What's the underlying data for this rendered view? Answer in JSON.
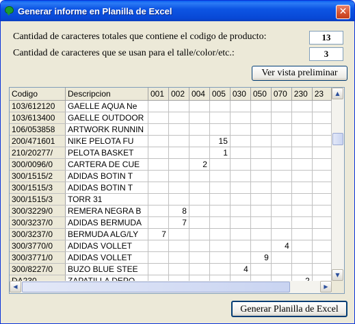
{
  "window": {
    "title": "Generar informe en Planilla de Excel",
    "close_symbol": "✕",
    "icon": "speech-bubble-icon"
  },
  "form": {
    "product_code_label": "Cantidad de caracteres totales que contiene el codigo de producto:",
    "product_code_value": "13",
    "size_color_label": "Cantidad de caracteres que se usan para el talle/color/etc.:",
    "size_color_value": "3",
    "preview_button": "Ver vista preliminar"
  },
  "grid": {
    "columns": [
      "Codigo",
      "Descripcion",
      "001",
      "002",
      "004",
      "005",
      "030",
      "050",
      "070",
      "230",
      "23"
    ],
    "rows": [
      {
        "codigo": "103/612120",
        "descripcion": "GAELLE AQUA Ne",
        "values": [
          "",
          "",
          "",
          "",
          "",
          "",
          "",
          "",
          ""
        ]
      },
      {
        "codigo": "103/613400",
        "descripcion": "GAELLE OUTDOOR",
        "values": [
          "",
          "",
          "",
          "",
          "",
          "",
          "",
          "",
          ""
        ]
      },
      {
        "codigo": "106/053858",
        "descripcion": "ARTWORK RUNNIN",
        "values": [
          "",
          "",
          "",
          "",
          "",
          "",
          "",
          "",
          ""
        ]
      },
      {
        "codigo": "200/471601",
        "descripcion": "NIKE PELOTA FU",
        "values": [
          "",
          "",
          "",
          "15",
          "",
          "",
          "",
          "",
          ""
        ]
      },
      {
        "codigo": "210/20277/",
        "descripcion": "PELOTA BASKET",
        "values": [
          "",
          "",
          "",
          "1",
          "",
          "",
          "",
          "",
          ""
        ]
      },
      {
        "codigo": "300/0096/0",
        "descripcion": "CARTERA DE CUE",
        "values": [
          "",
          "",
          "2",
          "",
          "",
          "",
          "",
          "",
          ""
        ]
      },
      {
        "codigo": "300/1515/2",
        "descripcion": "ADIDAS BOTIN T",
        "values": [
          "",
          "",
          "",
          "",
          "",
          "",
          "",
          "",
          ""
        ]
      },
      {
        "codigo": "300/1515/3",
        "descripcion": "ADIDAS BOTIN T",
        "values": [
          "",
          "",
          "",
          "",
          "",
          "",
          "",
          "",
          ""
        ]
      },
      {
        "codigo": "300/1515/3",
        "descripcion": "TORR 31",
        "values": [
          "",
          "",
          "",
          "",
          "",
          "",
          "",
          "",
          ""
        ]
      },
      {
        "codigo": "300/3229/0",
        "descripcion": "REMERA NEGRA B",
        "values": [
          "",
          "8",
          "",
          "",
          "",
          "",
          "",
          "",
          ""
        ]
      },
      {
        "codigo": "300/3237/0",
        "descripcion": "ADIDAS BERMUDA",
        "values": [
          "",
          "7",
          "",
          "",
          "",
          "",
          "",
          "",
          ""
        ]
      },
      {
        "codigo": "300/3237/0",
        "descripcion": "BERMUDA ALG/LY",
        "values": [
          "7",
          "",
          "",
          "",
          "",
          "",
          "",
          "",
          ""
        ]
      },
      {
        "codigo": "300/3770/0",
        "descripcion": "ADIDAS VOLLET",
        "values": [
          "",
          "",
          "",
          "",
          "",
          "",
          "4",
          "",
          ""
        ]
      },
      {
        "codigo": "300/3771/0",
        "descripcion": "ADIDAS VOLLET",
        "values": [
          "",
          "",
          "",
          "",
          "",
          "9",
          "",
          "",
          ""
        ]
      },
      {
        "codigo": "300/8227/0",
        "descripcion": "BUZO BLUE STEE",
        "values": [
          "",
          "",
          "",
          "",
          "4",
          "",
          "",
          "",
          ""
        ]
      },
      {
        "codigo": "DA230",
        "descripcion": "ZAPATILLA DEPO",
        "values": [
          "",
          "",
          "",
          "",
          "",
          "",
          "",
          "2",
          ""
        ]
      }
    ],
    "scroll_up": "▲",
    "scroll_down": "▼",
    "scroll_left": "◀",
    "scroll_right": "▶"
  },
  "footer": {
    "generate_button": "Generar Planilla de Excel"
  },
  "colors": {
    "titlebar": "#0848d6",
    "window_bg": "#ece9d8",
    "close_button": "#d4512e"
  }
}
